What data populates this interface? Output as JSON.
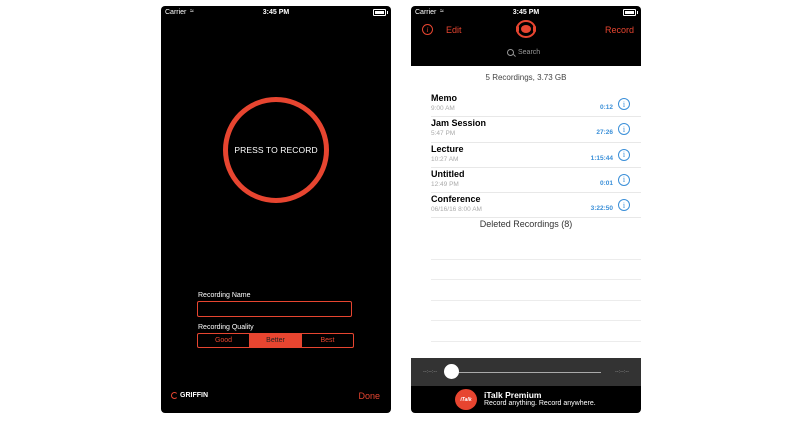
{
  "status": {
    "carrier": "Carrier",
    "time": "3:45 PM"
  },
  "recorder": {
    "press_label": "PRESS TO RECORD",
    "name_label": "Recording Name",
    "name_value": "",
    "quality_label": "Recording Quality",
    "quality_options": [
      "Good",
      "Better",
      "Best"
    ],
    "quality_selected": "Better",
    "brand": "GRIFFIN",
    "done_label": "Done"
  },
  "library": {
    "edit_label": "Edit",
    "record_label": "Record",
    "search_placeholder": "Search",
    "summary": "5 Recordings, 3.73 GB",
    "recordings": [
      {
        "title": "Memo",
        "subtitle": "9:00 AM",
        "duration": "0:12"
      },
      {
        "title": "Jam Session",
        "subtitle": "5:47 PM",
        "duration": "27:26"
      },
      {
        "title": "Lecture",
        "subtitle": "10:27 AM",
        "duration": "1:15:44"
      },
      {
        "title": "Untitled",
        "subtitle": "12:49 PM",
        "duration": "0:01"
      },
      {
        "title": "Conference",
        "subtitle": "06/16/16 8:00 AM",
        "duration": "3:22:50"
      }
    ],
    "deleted": "Deleted Recordings (8)",
    "player": {
      "elapsed": "--:--:--",
      "remaining": "--:--:--",
      "progress": 0
    },
    "promo": {
      "logo": "iTalk",
      "title": "iTalk Premium",
      "subtitle": "Record anything. Record anywhere."
    }
  },
  "colors": {
    "accent": "#e74530",
    "link": "#3a8fd8"
  },
  "icons": [
    "wifi-icon",
    "battery-icon",
    "info-icon",
    "italk-logo-icon",
    "search-icon",
    "griffin-logo-icon"
  ]
}
